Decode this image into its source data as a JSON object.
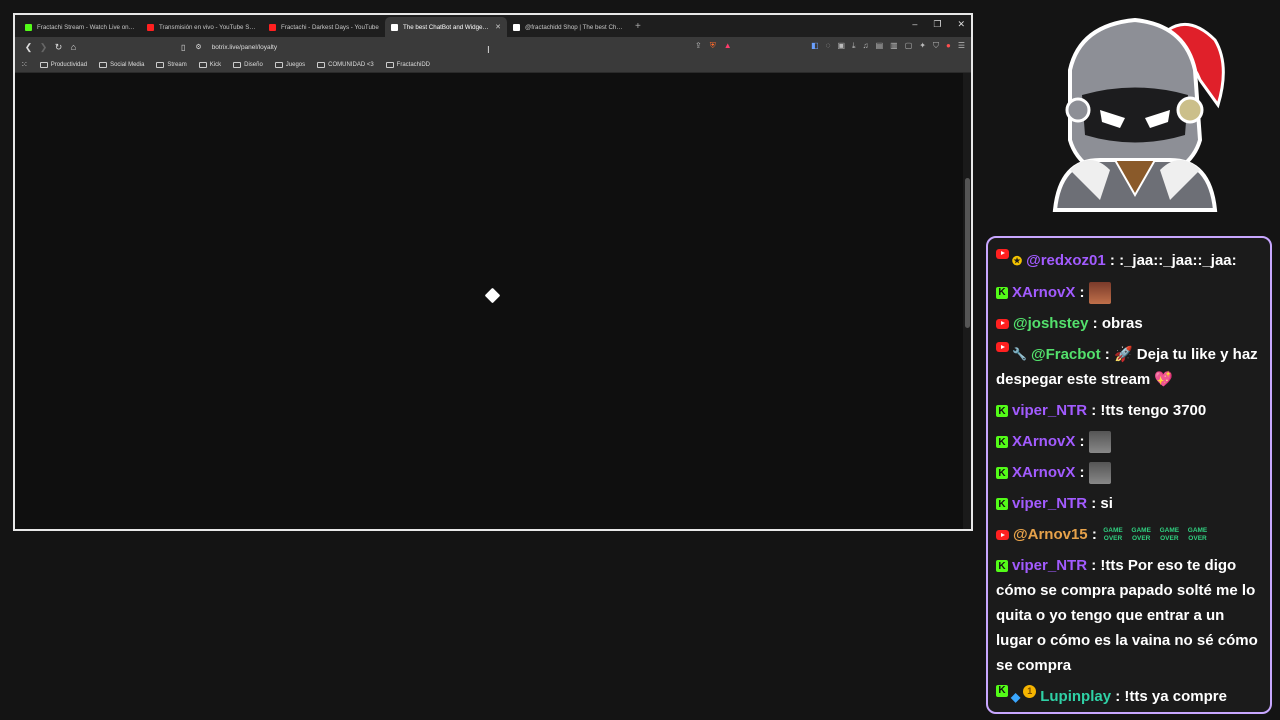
{
  "browser": {
    "tabs": [
      {
        "label": "Fractachi Stream - Watch Live on Kick",
        "favicon_color": "#53fc18",
        "active": false
      },
      {
        "label": "Transmisión en vivo - YouTube Studio",
        "favicon_color": "#ff2020",
        "active": false
      },
      {
        "label": "Fractachi - Darkest Days - YouTube",
        "favicon_color": "#ff2020",
        "active": false
      },
      {
        "label": "The best ChatBot and Widgets f",
        "favicon_color": "#ffffff",
        "active": true
      },
      {
        "label": "@fractachidd Shop | The best ChatB",
        "favicon_color": "#ffffff",
        "active": false
      }
    ],
    "new_tab_symbol": "+",
    "url": "botrix.live/panel/loyalty",
    "bookmarks": [
      "Productividad",
      "Social Media",
      "Stream",
      "Kick",
      "Diseño",
      "Juegos",
      "COMUNIDAD <3",
      "FractachiDD"
    ]
  },
  "chat": {
    "messages": [
      {
        "badges": [
          "youtube-icon",
          "star-icon"
        ],
        "user": "@redxoz01",
        "color": "#a25bff",
        "text": ":_jaa::_jaa::_jaa:"
      },
      {
        "badges": [
          "kick-icon"
        ],
        "user": "XArnovX",
        "color": "#a25bff",
        "text": "",
        "emote": "emote-face"
      },
      {
        "badges": [
          "youtube-icon"
        ],
        "user": "@joshstey",
        "color": "#53e06c",
        "text": "obras"
      },
      {
        "badges": [
          "youtube-icon",
          "wrench-icon"
        ],
        "user": "@Fracbot",
        "color": "#53e06c",
        "text": "🚀 Deja tu like y haz despegar este stream 💖"
      },
      {
        "badges": [
          "kick-icon"
        ],
        "user": "viper_NTR",
        "color": "#a25bff",
        "text": "!tts tengo 3700"
      },
      {
        "badges": [
          "kick-icon"
        ],
        "user": "XArnovX",
        "color": "#a25bff",
        "text": "",
        "emote": "emote-gray"
      },
      {
        "badges": [
          "kick-icon"
        ],
        "user": "XArnovX",
        "color": "#a25bff",
        "text": "",
        "emote": "emote-gray"
      },
      {
        "badges": [
          "kick-icon"
        ],
        "user": "viper_NTR",
        "color": "#a25bff",
        "text": "si"
      },
      {
        "badges": [
          "youtube-icon"
        ],
        "user": "@Arnov15",
        "color": "#e7a24a",
        "text": "",
        "emote": "gameover-x4"
      },
      {
        "badges": [
          "kick-icon"
        ],
        "user": "viper_NTR",
        "color": "#a25bff",
        "text": "!tts Por eso te digo cómo se compra papado solté me lo quita o yo tengo que entrar a un lugar o cómo es la vaina no sé cómo se compra"
      },
      {
        "badges": [
          "kick-icon",
          "cube-icon",
          "coin-icon"
        ],
        "user": "Lupinplay",
        "color": "#2fd1a6",
        "text": "!tts ya compre"
      }
    ],
    "gameover_label": "GAME OVER"
  }
}
